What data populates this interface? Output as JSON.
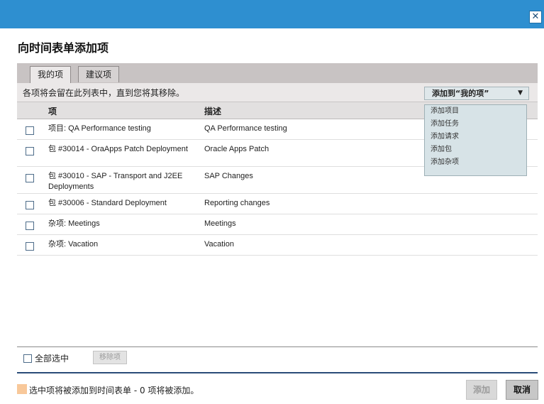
{
  "window": {
    "close_glyph": "✕"
  },
  "dialog": {
    "title": "向时间表单添加项"
  },
  "tabs": [
    {
      "label": "我的项",
      "active": true
    },
    {
      "label": "建议项",
      "active": false
    }
  ],
  "info": {
    "message": "各项将会留在此列表中，直到您将其移除。"
  },
  "add_dropdown": {
    "label": "添加到“我的项”",
    "arrow": "▼",
    "options": [
      "添加项目",
      "添加任务",
      "添加请求",
      "添加包",
      "添加杂项"
    ]
  },
  "table": {
    "headers": {
      "item": "项",
      "description": "描述"
    },
    "rows": [
      {
        "item": "项目: QA Performance testing",
        "description": "QA Performance testing"
      },
      {
        "item": "包 #30014 - OraApps Patch Deployment",
        "description": "Oracle Apps Patch"
      },
      {
        "item": "包 #30010 - SAP - Transport and J2EE Deployments",
        "description": "SAP Changes"
      },
      {
        "item": "包 #30006 - Standard Deployment",
        "description": "Reporting changes"
      },
      {
        "item": "杂项: Meetings",
        "description": "Meetings"
      },
      {
        "item": "杂项: Vacation",
        "description": "Vacation"
      }
    ]
  },
  "footer": {
    "select_all_label": "全部选中",
    "remove_label": "移除项",
    "legend_text": "选中项将被添加到时间表单  - 0 项将被添加。",
    "add_label": "添加",
    "cancel_label": "取消"
  },
  "colors": {
    "title_bar": "#2e8fd0",
    "legend_swatch": "#f8c89a",
    "rule": "#2a4c78"
  }
}
